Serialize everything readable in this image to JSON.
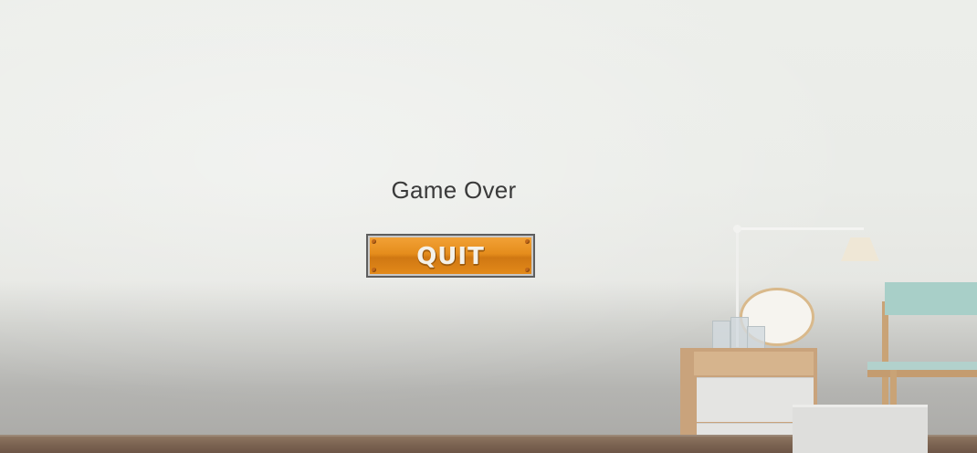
{
  "screen": {
    "title": "Game Over",
    "quit_button_label": "QUIT"
  },
  "colors": {
    "button_orange": "#e58d1c",
    "title_text": "#3a3a3a",
    "wall": "#eceeea",
    "floor": "#7b6351"
  },
  "background": {
    "scene": "room-interior",
    "objects": [
      "floor-lamp",
      "round-mirror",
      "glass-jars",
      "bedside-cabinet",
      "chair",
      "storage-box"
    ]
  }
}
